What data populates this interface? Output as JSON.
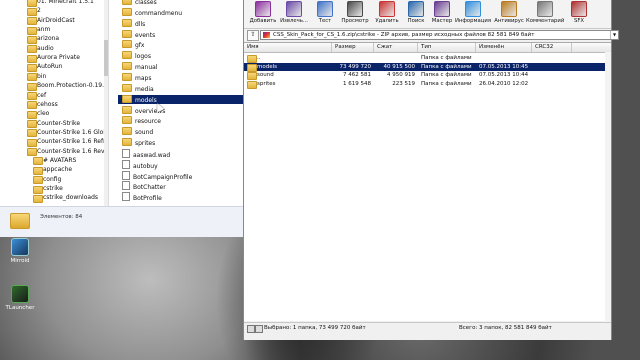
{
  "tree": {
    "items": [
      {
        "label": "01. Minecraft 1.5.1",
        "sub": false
      },
      {
        "label": "2",
        "sub": false
      },
      {
        "label": "AirDroidCast",
        "sub": false
      },
      {
        "label": "anm",
        "sub": false
      },
      {
        "label": "arizona",
        "sub": false
      },
      {
        "label": "audio",
        "sub": false
      },
      {
        "label": "Aurora Private",
        "sub": false
      },
      {
        "label": "AutoRun",
        "sub": false
      },
      {
        "label": "bin",
        "sub": false
      },
      {
        "label": "Boom.Protection-0.19.1 mer",
        "sub": false
      },
      {
        "label": "cef",
        "sub": false
      },
      {
        "label": "cehoss",
        "sub": false
      },
      {
        "label": "cleo",
        "sub": false
      },
      {
        "label": "Counter-Strike",
        "sub": false
      },
      {
        "label": "Counter-Strike 1.6 Global Of",
        "sub": false
      },
      {
        "label": "Counter-Strike 1.6 Refresh",
        "sub": false
      },
      {
        "label": "Counter-Strike 1.6 Revolt",
        "sub": false
      },
      {
        "label": "# AVATARS",
        "sub": true
      },
      {
        "label": "appcache",
        "sub": true
      },
      {
        "label": "config",
        "sub": true
      },
      {
        "label": "cstrike",
        "sub": true
      },
      {
        "label": "cstrike_downloads",
        "sub": true
      }
    ]
  },
  "list": {
    "items": [
      {
        "label": "classes",
        "type": "folder"
      },
      {
        "label": "commandmenu",
        "type": "folder"
      },
      {
        "label": "dlls",
        "type": "folder"
      },
      {
        "label": "events",
        "type": "folder"
      },
      {
        "label": "gfx",
        "type": "folder"
      },
      {
        "label": "logos",
        "type": "folder"
      },
      {
        "label": "manual",
        "type": "folder"
      },
      {
        "label": "maps",
        "type": "folder"
      },
      {
        "label": "media",
        "type": "folder"
      },
      {
        "label": "models",
        "type": "folder"
      },
      {
        "label": "overviews",
        "type": "folder"
      },
      {
        "label": "resource",
        "type": "folder"
      },
      {
        "label": "sound",
        "type": "folder"
      },
      {
        "label": "sprites",
        "type": "folder"
      },
      {
        "label": "aaswad.wad",
        "type": "file"
      },
      {
        "label": "autobuy",
        "type": "file"
      },
      {
        "label": "BotCampaignProfile",
        "type": "file"
      },
      {
        "label": "BotChatter",
        "type": "file"
      },
      {
        "label": "BotProfile",
        "type": "file"
      }
    ]
  },
  "explorer_footer": {
    "count": "Элементов: 84"
  },
  "winrar": {
    "toolbar": [
      {
        "label": "Добавить",
        "icon": "add-icon",
        "color": "#8c2f9e"
      },
      {
        "label": "Извлечь...",
        "icon": "extract-icon",
        "color": "#6b4aa8"
      },
      {
        "label": "Тест",
        "icon": "test-icon",
        "color": "#3f72c8"
      },
      {
        "label": "Просмотр",
        "icon": "view-icon",
        "color": "#4a4a4a"
      },
      {
        "label": "Удалить",
        "icon": "delete-icon",
        "color": "#c33"
      },
      {
        "label": "Поиск",
        "icon": "find-icon",
        "color": "#2a66aa"
      },
      {
        "label": "Мастер",
        "icon": "wizard-icon",
        "color": "#6a3d91"
      },
      {
        "label": "Информация",
        "icon": "info-icon",
        "color": "#2f8fdf"
      },
      {
        "label": "Антивирус",
        "icon": "antivirus-icon",
        "color": "#b97a20"
      },
      {
        "label": "Комментарий",
        "icon": "comment-icon",
        "color": "#777"
      },
      {
        "label": "SFX",
        "icon": "sfx-icon",
        "color": "#b03030"
      }
    ],
    "address": "CSS_Skin_Pack_for_CS_1.6.zip\\cstrike - ZIP архив, размер исходных файлов 82 581 849 байт",
    "headers": [
      "Имя",
      "Размер",
      "Сжат",
      "Тип",
      "Изменён",
      "CRC32"
    ],
    "rows": [
      {
        "name": "..",
        "size": "",
        "packed": "",
        "type": "Папка с файлами",
        "modified": ""
      },
      {
        "name": "models",
        "size": "73 499 720",
        "packed": "40 915 500",
        "type": "Папка с файлами",
        "modified": "07.05.2013 10:45"
      },
      {
        "name": "sound",
        "size": "7 462 581",
        "packed": "4 950 919",
        "type": "Папка с файлами",
        "modified": "07.05.2013 10:44"
      },
      {
        "name": "sprites",
        "size": "1 619 548",
        "packed": "223 519",
        "type": "Папка с файлами",
        "modified": "26.04.2010 12:02"
      }
    ],
    "status_left": "Выбрано: 1 папка, 73 499 720 байт",
    "status_right": "Всего: 3 папок, 82 581 849 байт"
  },
  "desktop": {
    "icons": [
      {
        "label": "Mirroid"
      },
      {
        "label": "TLauncher"
      }
    ]
  }
}
